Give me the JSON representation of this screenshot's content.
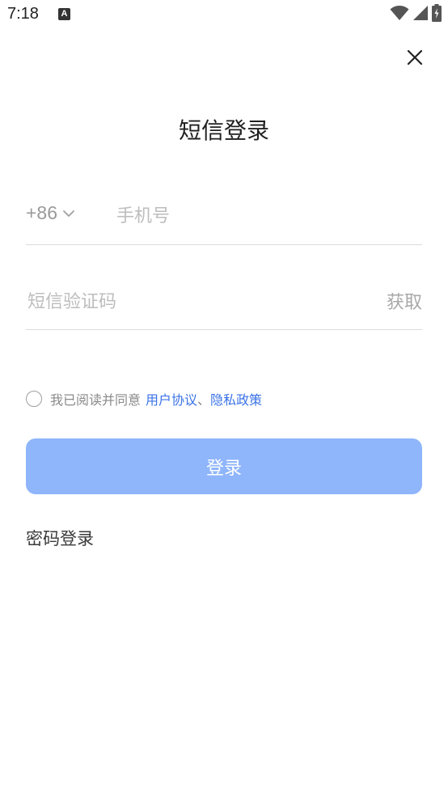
{
  "status_bar": {
    "time": "7:18",
    "notification_icon_letter": "A",
    "icons": [
      "wifi-icon",
      "signal-icon",
      "battery-charging-icon"
    ]
  },
  "header": {
    "title": "短信登录",
    "close_icon": "close-icon"
  },
  "phone": {
    "country_code": "+86",
    "placeholder": "手机号",
    "value": ""
  },
  "sms_code": {
    "placeholder": "短信验证码",
    "value": "",
    "get_code_label": "获取"
  },
  "agreement": {
    "checked": false,
    "prefix": "我已阅读并同意",
    "user_agreement": "用户协议",
    "separator": "、",
    "privacy_policy": "隐私政策"
  },
  "login_button": {
    "label": "登录"
  },
  "password_login": {
    "label": "密码登录"
  },
  "colors": {
    "accent": "#3b73e6",
    "button_disabled": "#8fb5fb",
    "placeholder": "#bdbdbd",
    "divider": "#dcdcdc"
  }
}
